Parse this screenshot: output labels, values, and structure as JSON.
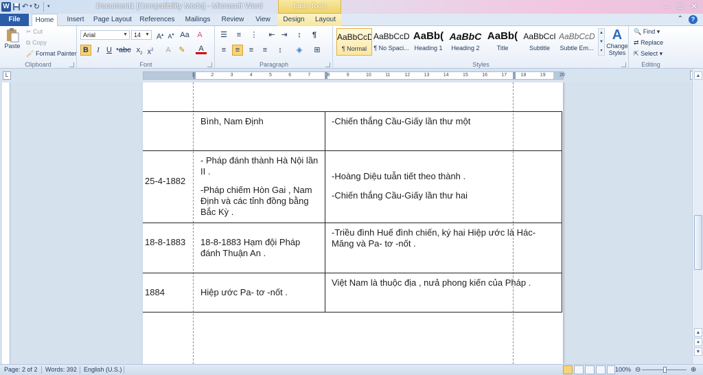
{
  "window": {
    "title": "Document1 [Compatibility Mode]  -  Microsoft Word",
    "table_tools": "Table Tools",
    "controls": [
      "–",
      "□",
      "✕"
    ]
  },
  "tabs": [
    "File",
    "Home",
    "Insert",
    "Page Layout",
    "References",
    "Mailings",
    "Review",
    "View",
    "Design",
    "Layout"
  ],
  "clipboard": {
    "paste": "Paste",
    "cut": "Cut",
    "copy": "Copy",
    "format_painter": "Format Painter",
    "label": "Clipboard"
  },
  "font": {
    "name": "Arial",
    "size": "14",
    "label": "Font"
  },
  "paragraph": {
    "label": "Paragraph"
  },
  "styles": {
    "label": "Styles",
    "items": [
      {
        "sample": "AaBbCcDc",
        "name": "¶ Normal"
      },
      {
        "sample": "AaBbCcDc",
        "name": "¶ No Spaci..."
      },
      {
        "sample": "AaBb(",
        "name": "Heading 1"
      },
      {
        "sample": "AaBbC",
        "name": "Heading 2"
      },
      {
        "sample": "AaBb(",
        "name": "Title"
      },
      {
        "sample": "AaBbCcI",
        "name": "Subtitle"
      },
      {
        "sample": "AaBbCcDc",
        "name": "Subtle Em..."
      }
    ],
    "change_styles": "Change Styles"
  },
  "editing": {
    "find": "Find",
    "replace": "Replace",
    "select": "Select",
    "label": "Editing"
  },
  "ruler": [
    "1",
    "2",
    "3",
    "4",
    "5",
    "6",
    "7",
    "8",
    "9",
    "10",
    "11",
    "12",
    "13",
    "14",
    "15",
    "16",
    "17",
    "18",
    "19",
    "20"
  ],
  "table": {
    "rows": [
      {
        "date": "",
        "event": "Bình, Nam Định",
        "result": "-Chiến thắng Cầu-Giấy lần thư một"
      },
      {
        "date": "25-4-1882",
        "event_1": "- Pháp đánh thành Hà Nội lần II .",
        "event_2": "-Pháp chiếm Hòn Gai , Nam Định  và các tỉnh đồng bằng Bắc Kỳ .",
        "result_1": "-Hoàng Diệu  tuẫn tiết theo thành .",
        "result_2": "-Chiến thắng Cầu-Giấy lần thư hai"
      },
      {
        "date": "18-8-1883",
        "event": "18-8-1883 Hạm đội Pháp đánh Thuận An .",
        "result": "-Triều đình Huế  đình chiến, ký hai Hiệp ước  là Hác- Măng và Pa- tơ -nốt ."
      },
      {
        "date": "1884",
        "event": "Hiệp ước  Pa- tơ -nốt .",
        "result": "Việt Nam là thuộc địa , nưả phong kiến của Pháp ."
      }
    ]
  },
  "status": {
    "page": "Page: 2 of 2",
    "words": "Words: 392",
    "language": "English (U.S.)",
    "zoom": "100%",
    "zoom_level": 1.0
  }
}
